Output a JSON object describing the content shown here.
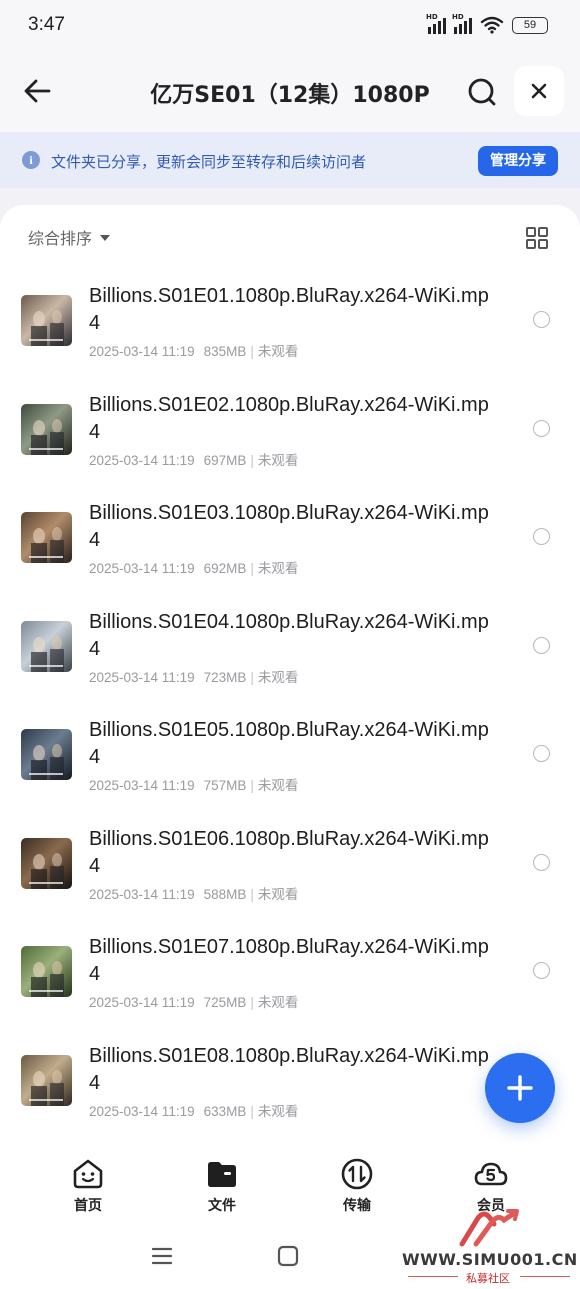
{
  "status_bar": {
    "time": "3:47",
    "battery": "59",
    "signal_label_1": "HD",
    "signal_label_2": "HD"
  },
  "header": {
    "title": "亿万SE01（12集）1080P"
  },
  "banner": {
    "text": "文件夹已分享，更新会同步至转存和后续访问者",
    "manage_label": "管理分享"
  },
  "sort": {
    "label": "综合排序"
  },
  "files": [
    {
      "name": "Billions.S01E01.1080p.BluRay.x264-WiKi.mp4",
      "date": "2025-03-14 11:19",
      "size": "835MB",
      "status": "未观看"
    },
    {
      "name": "Billions.S01E02.1080p.BluRay.x264-WiKi.mp4",
      "date": "2025-03-14 11:19",
      "size": "697MB",
      "status": "未观看"
    },
    {
      "name": "Billions.S01E03.1080p.BluRay.x264-WiKi.mp4",
      "date": "2025-03-14 11:19",
      "size": "692MB",
      "status": "未观看"
    },
    {
      "name": "Billions.S01E04.1080p.BluRay.x264-WiKi.mp4",
      "date": "2025-03-14 11:19",
      "size": "723MB",
      "status": "未观看"
    },
    {
      "name": "Billions.S01E05.1080p.BluRay.x264-WiKi.mp4",
      "date": "2025-03-14 11:19",
      "size": "757MB",
      "status": "未观看"
    },
    {
      "name": "Billions.S01E06.1080p.BluRay.x264-WiKi.mp4",
      "date": "2025-03-14 11:19",
      "size": "588MB",
      "status": "未观看"
    },
    {
      "name": "Billions.S01E07.1080p.BluRay.x264-WiKi.mp4",
      "date": "2025-03-14 11:19",
      "size": "725MB",
      "status": "未观看"
    },
    {
      "name": "Billions.S01E08.1080p.BluRay.x264-WiKi.mp4",
      "date": "2025-03-14 11:19",
      "size": "633MB",
      "status": "未观看"
    }
  ],
  "nav": [
    {
      "label": "首页",
      "icon": "home-face-icon"
    },
    {
      "label": "文件",
      "icon": "folder-icon"
    },
    {
      "label": "传输",
      "icon": "transfer-icon"
    },
    {
      "label": "会员",
      "icon": "vip-cloud-icon"
    }
  ],
  "watermark": {
    "text": "WWW.SIMU001.CN",
    "sub": "私募社区"
  },
  "colors": {
    "accent": "#2567e8",
    "banner_bg": "#e8ecf8",
    "banner_text": "#2f5bb8"
  }
}
